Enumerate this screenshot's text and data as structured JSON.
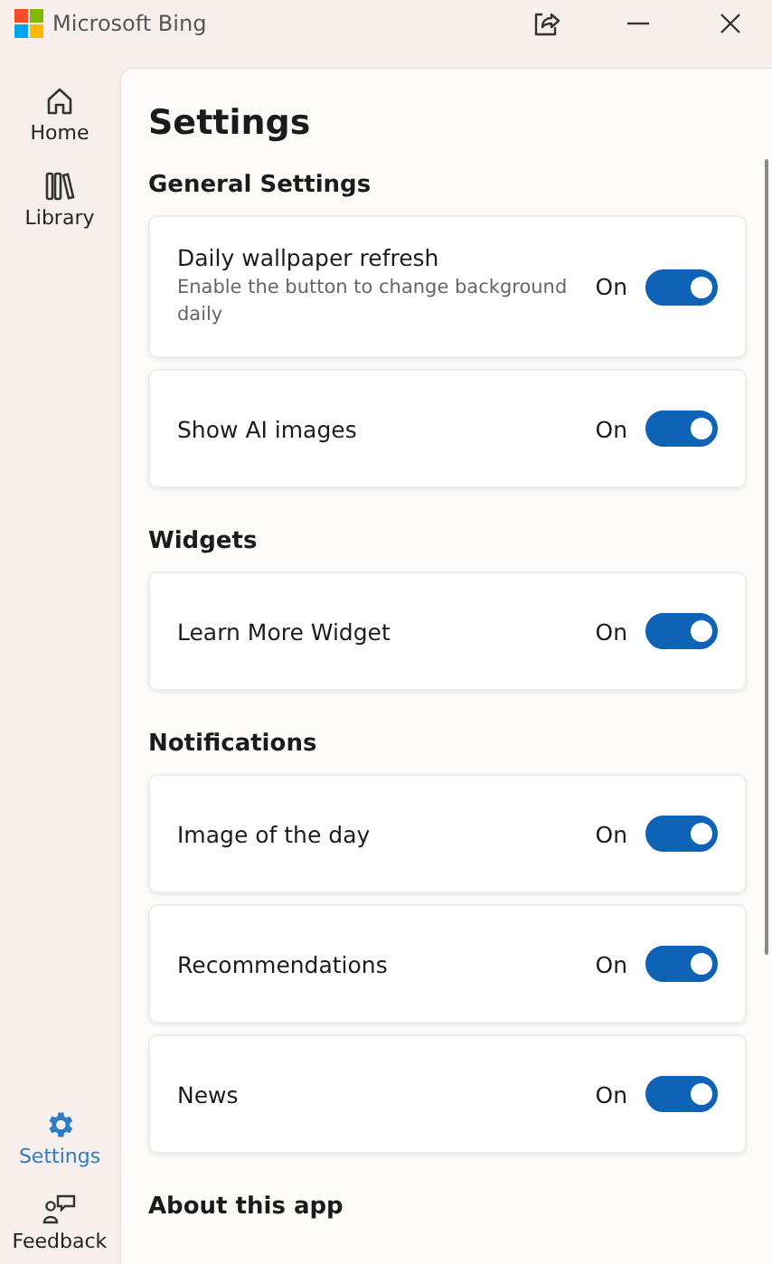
{
  "window": {
    "title": "Microsoft Bing"
  },
  "sidebar": {
    "items": [
      {
        "label": "Home",
        "kind": "home",
        "selected": false
      },
      {
        "label": "Library",
        "kind": "library",
        "selected": false
      },
      {
        "label": "Settings",
        "kind": "settings",
        "selected": true
      },
      {
        "label": "Feedback",
        "kind": "feedback",
        "selected": false
      }
    ]
  },
  "page_title": "Settings",
  "sections": [
    {
      "title": "General Settings",
      "items": [
        {
          "label": "Daily wallpaper refresh",
          "description": "Enable the button to change background daily",
          "state_label": "On",
          "on": true
        },
        {
          "label": "Show AI images",
          "state_label": "On",
          "on": true
        }
      ]
    },
    {
      "title": "Widgets",
      "items": [
        {
          "label": "Learn More Widget",
          "state_label": "On",
          "on": true
        }
      ]
    },
    {
      "title": "Notifications",
      "items": [
        {
          "label": "Image of the day",
          "state_label": "On",
          "on": true
        },
        {
          "label": "Recommendations",
          "state_label": "On",
          "on": true
        },
        {
          "label": "News",
          "state_label": "On",
          "on": true
        }
      ]
    },
    {
      "title": "About this app"
    }
  ]
}
